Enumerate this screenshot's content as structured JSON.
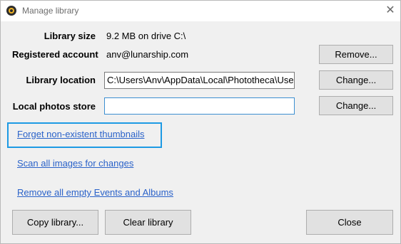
{
  "window": {
    "title": "Manage library",
    "close_glyph": "✕"
  },
  "fields": {
    "library_size_label": "Library size",
    "library_size_value": "9.2 MB on drive C:\\",
    "registered_account_label": "Registered account",
    "registered_account_value": "anv@lunarship.com",
    "library_location_label": "Library location",
    "library_location_value": "C:\\Users\\Anv\\AppData\\Local\\Phototheca\\Use",
    "local_photos_store_label": "Local photos store",
    "local_photos_store_value": ""
  },
  "buttons": {
    "remove": "Remove...",
    "change_location": "Change...",
    "change_store": "Change...",
    "copy_library": "Copy library...",
    "clear_library": "Clear library",
    "close": "Close"
  },
  "links": {
    "forget_thumbnails": "Forget non-existent thumbnails",
    "scan_images": "Scan all images for changes",
    "remove_empty": "Remove all empty Events and Albums"
  },
  "colors": {
    "link": "#2a62c9",
    "focus_border": "#1d9ae4"
  }
}
